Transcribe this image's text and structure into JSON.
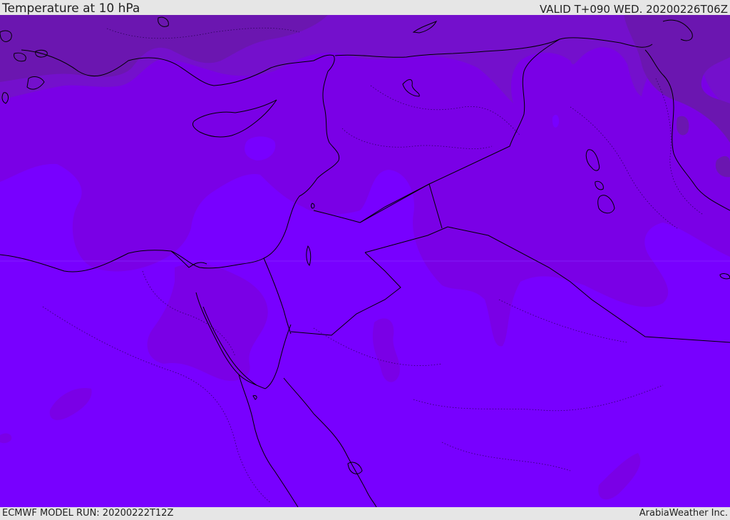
{
  "header": {
    "title": "Temperature at 10 hPa",
    "valid": "VALID T+090 WED. 20200226T06Z"
  },
  "footer": {
    "model_run": "ECMWF MODEL RUN: 20200222T12Z",
    "credit": "ArabiaWeather Inc."
  },
  "colors": {
    "base": "#7800ff",
    "band_mid": "#7a00e6",
    "band_dark": "#7410cc",
    "band_darkest": "#6b16b0",
    "coast": "#000000"
  }
}
